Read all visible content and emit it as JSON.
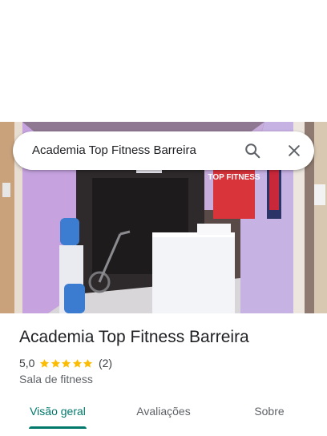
{
  "search": {
    "query": "Academia Top Fitness Barreira"
  },
  "place": {
    "name": "Academia Top Fitness Barreira",
    "rating": "5,0",
    "stars": 5,
    "review_count": "(2)",
    "category": "Sala de fitness"
  },
  "tabs": [
    {
      "label": "Visão geral",
      "active": true
    },
    {
      "label": "Avaliações",
      "active": false
    },
    {
      "label": "Sobre",
      "active": false
    }
  ],
  "colors": {
    "accent": "#00796b",
    "star": "#fbbc04",
    "text_primary": "#202124",
    "text_secondary": "#5f6368"
  },
  "photo": {
    "sign_text": "TOP FITNESS"
  },
  "icons": {
    "search": "search-icon",
    "close": "close-icon",
    "star": "star-icon"
  }
}
